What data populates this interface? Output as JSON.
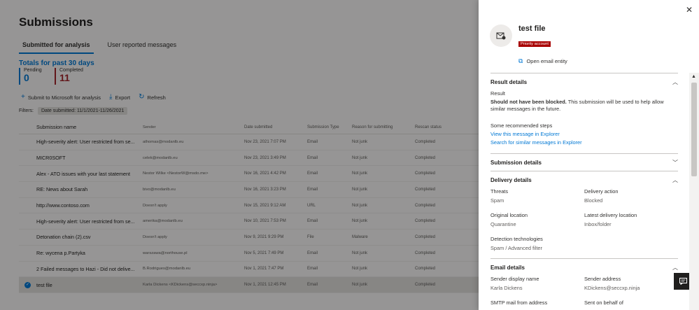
{
  "page": {
    "title": "Submissions",
    "tabs": [
      {
        "label": "Submitted for analysis",
        "active": true
      },
      {
        "label": "User reported messages",
        "active": false
      }
    ],
    "totals_title": "Totals for past 30 days",
    "pending": {
      "label": "Pending",
      "value": "0"
    },
    "completed": {
      "label": "Completed",
      "value": "11"
    },
    "actions": {
      "submit": "Submit to Microsoft for analysis",
      "export": "Export",
      "refresh": "Refresh"
    },
    "filters_label": "Filters:",
    "filter_chip": "Date submitted: 11/1/2021-11/26/2021"
  },
  "table": {
    "headers": [
      "Submission name",
      "Sender",
      "Date submitted",
      "Submission Type",
      "Reason for submitting",
      "Rescan status"
    ],
    "rows": [
      {
        "name": "High-severity alert: User restricted from se...",
        "sender": "athomas@modanlb.eu",
        "date": "Nov 23, 2021 7:07 PM",
        "type": "Email",
        "reason": "Not junk",
        "rescan": "Completed"
      },
      {
        "name": "MICR0SOFT",
        "sender": "celek@modanlb.eu",
        "date": "Nov 23, 2021 3:49 PM",
        "type": "Email",
        "reason": "Not junk",
        "rescan": "Completed"
      },
      {
        "name": "Alex - ATO issues with your last statement",
        "sender": "Nestor Wilke <NestorW@msdo.me>",
        "date": "Nov 16, 2021 4:42 PM",
        "type": "Email",
        "reason": "Not junk",
        "rescan": "Completed"
      },
      {
        "name": "RE: News about Sarah",
        "sender": "bivo@modanlb.eu",
        "date": "Nov 16, 2021 3:23 PM",
        "type": "Email",
        "reason": "Not junk",
        "rescan": "Completed"
      },
      {
        "name": "http://www.contoso.com",
        "sender": "Doesn't apply",
        "date": "Nov 15, 2021 9:12 AM",
        "type": "URL",
        "reason": "Not junk",
        "rescan": "Completed"
      },
      {
        "name": "High-severity alert: User restricted from se...",
        "sender": "amerika@modanlb.eu",
        "date": "Nov 10, 2021 7:53 PM",
        "type": "Email",
        "reason": "Not junk",
        "rescan": "Completed"
      },
      {
        "name": "Detonation chain (2).csv",
        "sender": "Doesn't apply",
        "date": "Nov 9, 2021 9:29 PM",
        "type": "File",
        "reason": "Malware",
        "rescan": "Completed"
      },
      {
        "name": "Re: wycena p.Partyka",
        "sender": "warszawa@northouse.pl",
        "date": "Nov 5, 2021 7:49 PM",
        "type": "Email",
        "reason": "Not junk",
        "rescan": "Completed"
      },
      {
        "name": "2 Failed messages to Hazi - Did not delive...",
        "sender": "B.Rodrigues@modanlb.eu",
        "date": "Nov 1, 2021 7:47 PM",
        "type": "Email",
        "reason": "Not junk",
        "rescan": "Completed"
      },
      {
        "name": "test file",
        "sender": "Karla Dickens <KDickens@seccxp.ninja>",
        "date": "Nov 1, 2021 12:45 PM",
        "type": "Email",
        "reason": "Not junk",
        "rescan": "Completed",
        "selected": true
      }
    ]
  },
  "panel": {
    "title": "test file",
    "badge": "Priority account",
    "open_entity": "Open email entity",
    "result_details": {
      "heading": "Result details",
      "result_label": "Result",
      "result_bold": "Should not have been blocked.",
      "result_text": " This submission will be used to help allow similar messages in the future.",
      "steps_label": "Some recommended steps",
      "link1": "View this message in Explorer",
      "link2": "Search for similar messages in Explorer"
    },
    "submission_details": {
      "heading": "Submission details"
    },
    "delivery_details": {
      "heading": "Delivery details",
      "threats_label": "Threats",
      "threats_value": "Spam",
      "action_label": "Delivery action",
      "action_value": "Blocked",
      "orig_label": "Original location",
      "orig_value": "Quarantine",
      "latest_label": "Latest delivery location",
      "latest_value": "Inbox/folder",
      "tech_label": "Detection technologies",
      "tech_value": "Spam / Advanced filter"
    },
    "email_details": {
      "heading": "Email details",
      "display_label": "Sender display name",
      "display_value": "Karla Dickens",
      "address_label": "Sender address",
      "address_value": "KDickens@seccxp.ninja",
      "smtp_label": "SMTP mail from address",
      "behalf_label": "Sent on behalf of"
    }
  },
  "colors": {
    "accent": "#0078d4",
    "priority": "#a80000",
    "completed_bar": "#a4262c"
  }
}
